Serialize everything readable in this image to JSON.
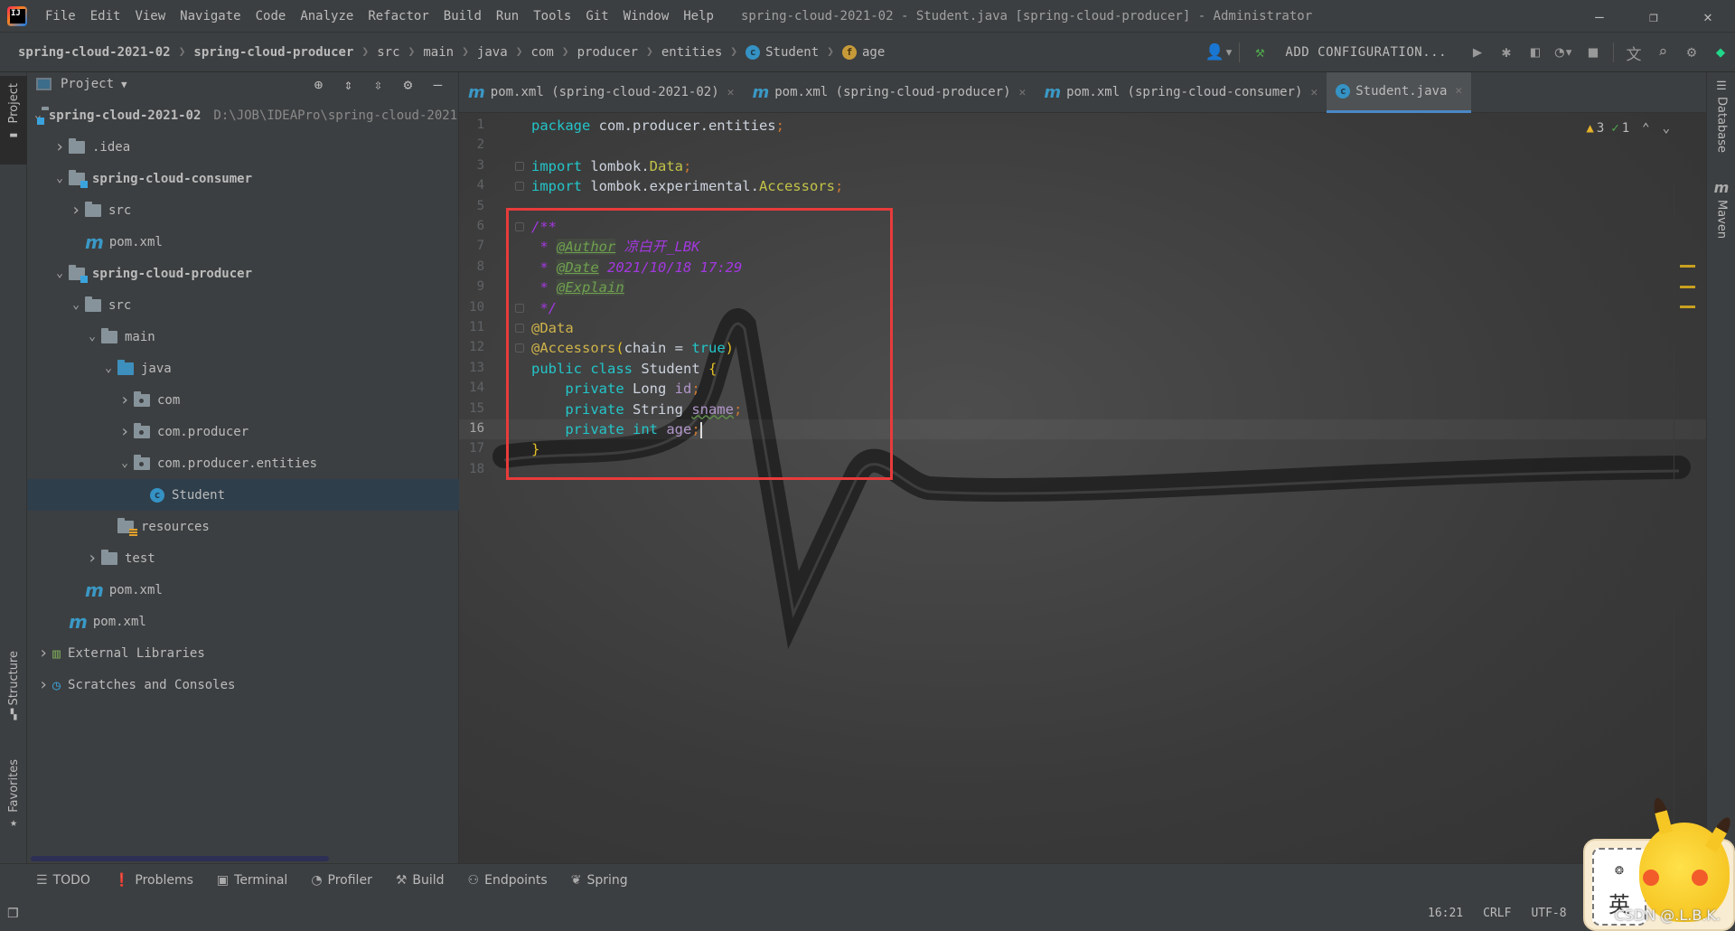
{
  "window": {
    "title": "spring-cloud-2021-02 - Student.java [spring-cloud-producer] - Administrator",
    "controls": {
      "minimize": "—",
      "restore": "❐",
      "close": "✕"
    }
  },
  "menu": [
    "File",
    "Edit",
    "View",
    "Navigate",
    "Code",
    "Analyze",
    "Refactor",
    "Build",
    "Run",
    "Tools",
    "Git",
    "Window",
    "Help"
  ],
  "breadcrumb": [
    {
      "label": "spring-cloud-2021-02",
      "bold": true
    },
    {
      "label": "spring-cloud-producer",
      "bold": true
    },
    {
      "label": "src"
    },
    {
      "label": "main"
    },
    {
      "label": "java"
    },
    {
      "label": "com"
    },
    {
      "label": "producer"
    },
    {
      "label": "entities"
    },
    {
      "label": "Student",
      "icon": "class-icon"
    },
    {
      "label": "age",
      "icon": "field-icon"
    }
  ],
  "toolbar": {
    "add_configuration": "ADD CONFIGURATION...",
    "icons": [
      "vcs-user-icon",
      "build-hammer-icon",
      "run-icon",
      "debug-icon",
      "coverage-icon",
      "profile-icon",
      "stop-icon",
      "translate-icon",
      "search-icon",
      "settings-icon",
      "toolbox-icon"
    ]
  },
  "left_stripe": {
    "project": "Project",
    "structure": "Structure",
    "favorites": "Favorites"
  },
  "right_stripe": {
    "database": "Database",
    "maven": "Maven"
  },
  "project_panel": {
    "title": "Project",
    "tree": [
      {
        "label": "spring-cloud-2021-02",
        "hint": "D:\\JOB\\IDEAPro\\spring-cloud-2021-",
        "depth": 0,
        "chevron": "down",
        "icon": "module",
        "bold": true
      },
      {
        "label": ".idea",
        "depth": 1,
        "chevron": "right",
        "icon": "folder"
      },
      {
        "label": "spring-cloud-consumer",
        "depth": 1,
        "chevron": "down",
        "icon": "module",
        "bold": true
      },
      {
        "label": "src",
        "depth": 2,
        "chevron": "right",
        "icon": "folder"
      },
      {
        "label": "pom.xml",
        "depth": 2,
        "chevron": "",
        "icon": "maven"
      },
      {
        "label": "spring-cloud-producer",
        "depth": 1,
        "chevron": "down",
        "icon": "module",
        "bold": true
      },
      {
        "label": "src",
        "depth": 2,
        "chevron": "down",
        "icon": "folder"
      },
      {
        "label": "main",
        "depth": 3,
        "chevron": "down",
        "icon": "folder"
      },
      {
        "label": "java",
        "depth": 4,
        "chevron": "down",
        "icon": "src"
      },
      {
        "label": "com",
        "depth": 5,
        "chevron": "right",
        "icon": "pkg"
      },
      {
        "label": "com.producer",
        "depth": 5,
        "chevron": "right",
        "icon": "pkg"
      },
      {
        "label": "com.producer.entities",
        "depth": 5,
        "chevron": "down",
        "icon": "pkg"
      },
      {
        "label": "Student",
        "depth": 6,
        "chevron": "",
        "icon": "class",
        "selected": true
      },
      {
        "label": "resources",
        "depth": 4,
        "chevron": "",
        "icon": "res"
      },
      {
        "label": "test",
        "depth": 3,
        "chevron": "right",
        "icon": "folder"
      },
      {
        "label": "pom.xml",
        "depth": 2,
        "chevron": "",
        "icon": "maven"
      },
      {
        "label": "pom.xml",
        "depth": 1,
        "chevron": "",
        "icon": "maven"
      },
      {
        "label": "External Libraries",
        "depth": 0,
        "chevron": "right",
        "icon": "libs"
      },
      {
        "label": "Scratches and Consoles",
        "depth": 0,
        "chevron": "right",
        "icon": "scratch"
      }
    ]
  },
  "editor": {
    "tabs": [
      {
        "label": "pom.xml (spring-cloud-2021-02)",
        "icon": "maven"
      },
      {
        "label": "pom.xml (spring-cloud-producer)",
        "icon": "maven"
      },
      {
        "label": "pom.xml (spring-cloud-consumer)",
        "icon": "maven"
      },
      {
        "label": "Student.java",
        "icon": "class",
        "active": true
      }
    ],
    "inspections": {
      "warnings": "3",
      "weak_warnings": "1"
    },
    "current_line": 16,
    "lines": [
      [
        [
          "kw",
          "package "
        ],
        [
          "pl",
          "com.producer.entities"
        ],
        [
          "sc",
          ";"
        ]
      ],
      [],
      [
        [
          "kw",
          "import "
        ],
        [
          "pl",
          "lombok."
        ],
        [
          "ty",
          "Data"
        ],
        [
          "sc",
          ";"
        ]
      ],
      [
        [
          "kw",
          "import "
        ],
        [
          "pl",
          "lombok.experimental."
        ],
        [
          "ty",
          "Accessors"
        ],
        [
          "sc",
          ";"
        ]
      ],
      [],
      [
        [
          "doc",
          "/**"
        ]
      ],
      [
        [
          "doc",
          " * "
        ],
        [
          "tag",
          "@Author"
        ],
        [
          "doc",
          " 凉白开_LBK"
        ]
      ],
      [
        [
          "doc",
          " * "
        ],
        [
          "tag",
          "@Date"
        ],
        [
          "doc",
          " 2021/10/18 17:29"
        ]
      ],
      [
        [
          "doc",
          " * "
        ],
        [
          "tag",
          "@Explain"
        ]
      ],
      [
        [
          "doc",
          " */"
        ]
      ],
      [
        [
          "an",
          "@Data"
        ]
      ],
      [
        [
          "an",
          "@Accessors"
        ],
        [
          "br",
          "("
        ],
        [
          "pl",
          "chain = "
        ],
        [
          "kw",
          "true"
        ],
        [
          "br",
          ")"
        ]
      ],
      [
        [
          "kw",
          "public class "
        ],
        [
          "pl",
          "Student "
        ],
        [
          "br",
          "{"
        ]
      ],
      [
        [
          "pl",
          "    "
        ],
        [
          "kw",
          "private "
        ],
        [
          "pl",
          "Long "
        ],
        [
          "fld",
          "id"
        ],
        [
          "sc",
          ";"
        ]
      ],
      [
        [
          "pl",
          "    "
        ],
        [
          "kw",
          "private "
        ],
        [
          "pl",
          "String "
        ],
        [
          "fld",
          "sname"
        ],
        [
          "sc",
          ";"
        ]
      ],
      [
        [
          "pl",
          "    "
        ],
        [
          "kw",
          "private int "
        ],
        [
          "fld",
          "age"
        ],
        [
          "sc",
          ";"
        ]
      ],
      [
        [
          "br",
          "}"
        ]
      ],
      []
    ]
  },
  "bottom_tabs": [
    {
      "label": "TODO",
      "icon": "☰"
    },
    {
      "label": "Problems",
      "icon": "❗"
    },
    {
      "label": "Terminal",
      "icon": "▣"
    },
    {
      "label": "Profiler",
      "icon": "◔"
    },
    {
      "label": "Build",
      "icon": "⚒"
    },
    {
      "label": "Endpoints",
      "icon": "⚇"
    },
    {
      "label": "Spring",
      "icon": "❦"
    }
  ],
  "status": {
    "position": "16:21",
    "line_sep": "CRLF",
    "encoding": "UTF-8",
    "indent": "4"
  },
  "watermark": "CSDN @.L.B.K."
}
